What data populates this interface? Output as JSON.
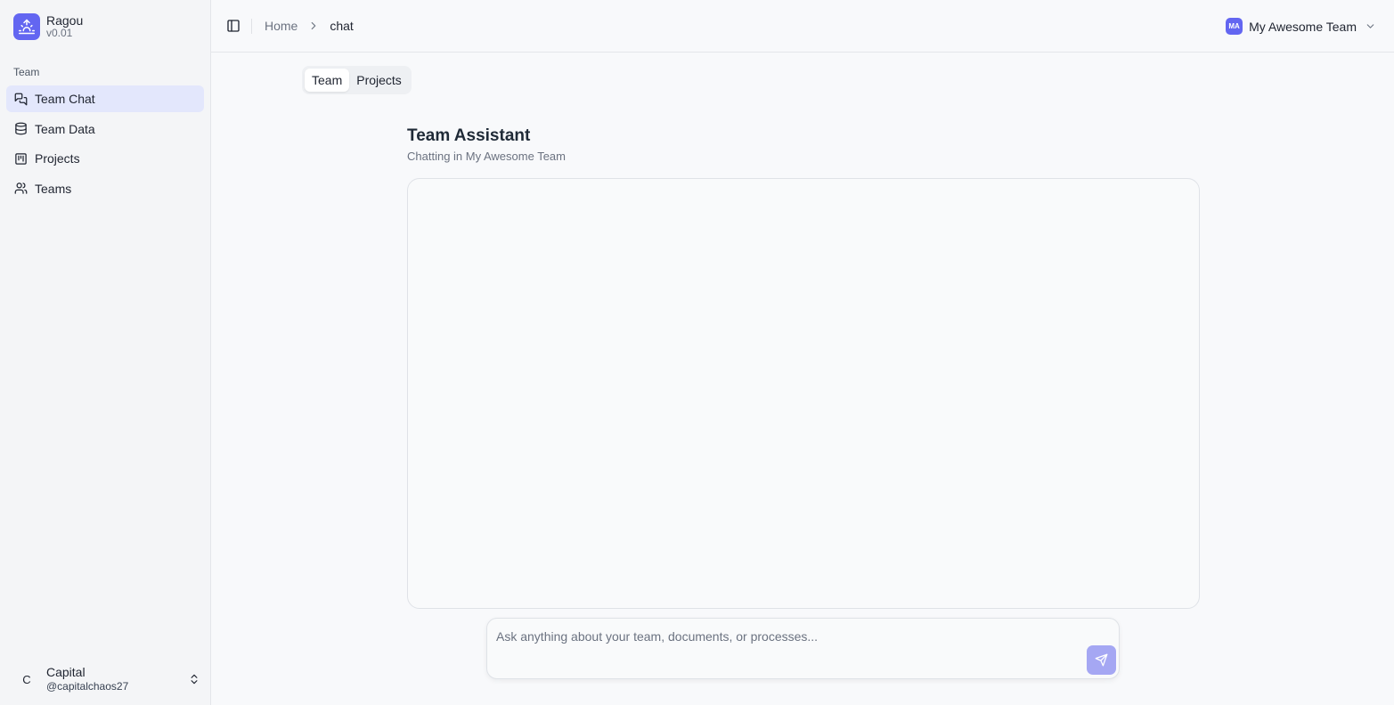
{
  "brand": {
    "name": "Ragou",
    "version": "v0.01",
    "logo_icon": "sunrise-icon",
    "accent": "#6366f1"
  },
  "sidebar": {
    "section_label": "Team",
    "items": [
      {
        "label": "Team Chat",
        "icon": "chat-bubbles-icon",
        "active": true
      },
      {
        "label": "Team Data",
        "icon": "database-icon",
        "active": false
      },
      {
        "label": "Projects",
        "icon": "kanban-icon",
        "active": false
      },
      {
        "label": "Teams",
        "icon": "users-icon",
        "active": false
      }
    ],
    "user": {
      "initial": "C",
      "name": "Capital",
      "handle": "@capitalchaos27"
    }
  },
  "header": {
    "breadcrumb": {
      "home": "Home",
      "current": "chat"
    },
    "team_switcher": {
      "badge": "MA",
      "name": "My Awesome Team"
    }
  },
  "tabs": [
    {
      "label": "Team",
      "active": true
    },
    {
      "label": "Projects",
      "active": false
    }
  ],
  "main": {
    "title": "Team Assistant",
    "subtitle": "Chatting in My Awesome Team",
    "composer": {
      "placeholder": "Ask anything about your team, documents, or processes...",
      "value": ""
    },
    "send_button_color": "#a5a7f3"
  }
}
